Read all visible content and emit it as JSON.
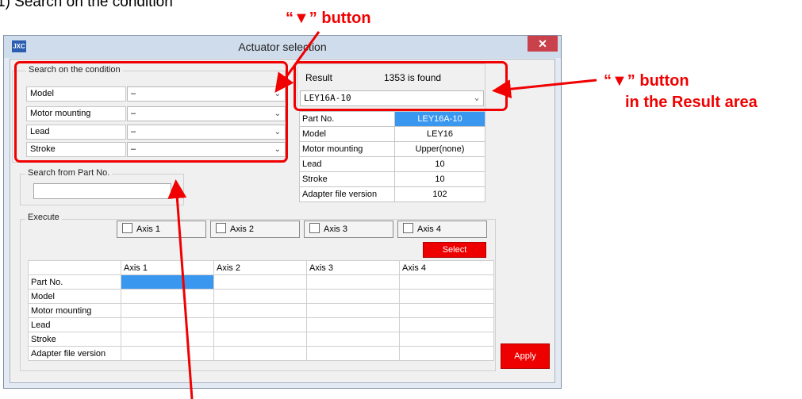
{
  "doc": {
    "heading": "1) Search on the condition"
  },
  "window": {
    "title": "Actuator selection",
    "icon_text": "JXC",
    "close_glyph": "✕"
  },
  "search_condition": {
    "title": "Search on the condition",
    "rows": [
      {
        "label": "Model",
        "value": "–"
      },
      {
        "label": "Motor mounting",
        "value": "–"
      },
      {
        "label": "Lead",
        "value": "–"
      },
      {
        "label": "Stroke",
        "value": "–"
      }
    ]
  },
  "search_part": {
    "title": "Search from Part No.",
    "value": ""
  },
  "result": {
    "label": "Result",
    "count_text": "1353 is found",
    "selected": "LEY16A-10",
    "rows": [
      {
        "key": "Part No.",
        "value": "LEY16A-10"
      },
      {
        "key": "Model",
        "value": "LEY16"
      },
      {
        "key": "Motor mounting",
        "value": "Upper(none)"
      },
      {
        "key": "Lead",
        "value": "10"
      },
      {
        "key": "Stroke",
        "value": "10"
      },
      {
        "key": "Adapter file version",
        "value": "102"
      }
    ]
  },
  "execute": {
    "title": "Execute",
    "axes": [
      "Axis 1",
      "Axis 2",
      "Axis 3",
      "Axis 4"
    ],
    "select_label": "Select",
    "table": {
      "headers": [
        "Axis 1",
        "Axis 2",
        "Axis 3",
        "Axis 4"
      ],
      "rows": [
        "Part No.",
        "Model",
        "Motor mounting",
        "Lead",
        "Stroke",
        "Adapter file version"
      ]
    },
    "apply_label": "Apply"
  },
  "annotations": {
    "top_button": "“▼” button",
    "result_button_line1": "“▼” button",
    "result_button_line2": "in the Result area"
  },
  "colors": {
    "highlight": "#f00000",
    "selection": "#3a97f0",
    "button_red": "#ee0000"
  }
}
